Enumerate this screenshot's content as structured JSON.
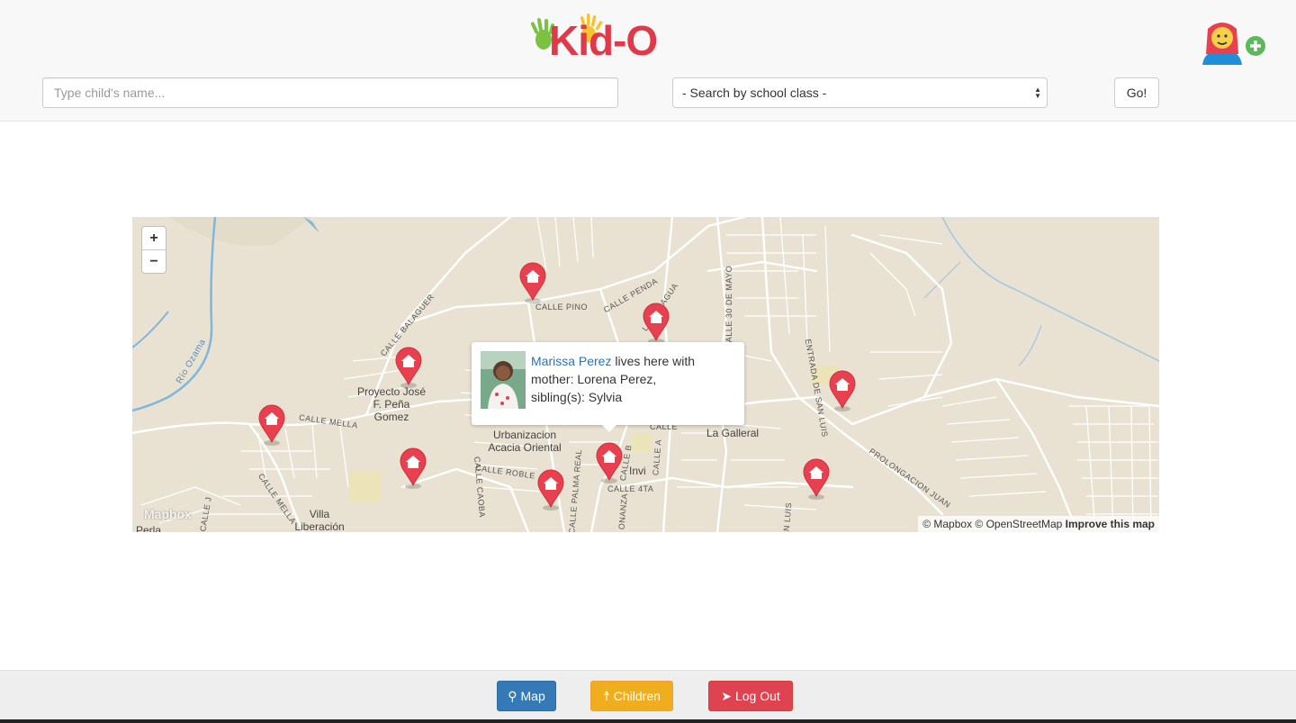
{
  "header": {
    "logo_text": "Kid-O",
    "add_user_icon": "add-user-icon",
    "search": {
      "placeholder": "Type child's name..."
    },
    "class_select": {
      "selected": "- Search by school class -"
    },
    "go_label": "Go!"
  },
  "map": {
    "zoom_in": "+",
    "zoom_out": "−",
    "places": [
      "Proyecto José F. Peña Gomez",
      "Urbanizacion Acacia Oriental",
      "La Galleral",
      "Villa Liberación",
      "Invi",
      "Perla"
    ],
    "streets": [
      "CALLE PINO",
      "CALLE PENDA",
      "CALLE BALAGUER",
      "CALLE MELLA",
      "CALLE MELLA",
      "CALLE CAOBA",
      "CALLE ROBLE",
      "CALLE PALMA REAL",
      "CALLE 4TA",
      "CALLE B",
      "CALLE A",
      "CALLE 30 DE MAYO",
      "ENTRADA DE SAN LUIS",
      "PROLONGACION JUAN",
      "Río Ozama",
      "CALLE J",
      "ONANZA",
      "N LUIS",
      "L BARRAGUA",
      "CALLE"
    ],
    "logo": "Mapbox",
    "attribution": {
      "text": "© Mapbox © OpenStreetMap",
      "improve": "Improve this map"
    },
    "marker_icon": "home-marker-icon",
    "popup": {
      "child_name": "Marissa Perez",
      "text1": " lives here with",
      "line2": "mother: Lorena Perez,",
      "line3": "sibling(s): Sylvia"
    }
  },
  "footer": {
    "map_label": "Map",
    "children_label": "Children",
    "logout_label": "Log Out"
  },
  "colors": {
    "map_button": "#337ab7",
    "children_button": "#f0ad1e",
    "logout_button": "#e04350",
    "marker": "#e8404f",
    "link": "#1c78c0"
  }
}
